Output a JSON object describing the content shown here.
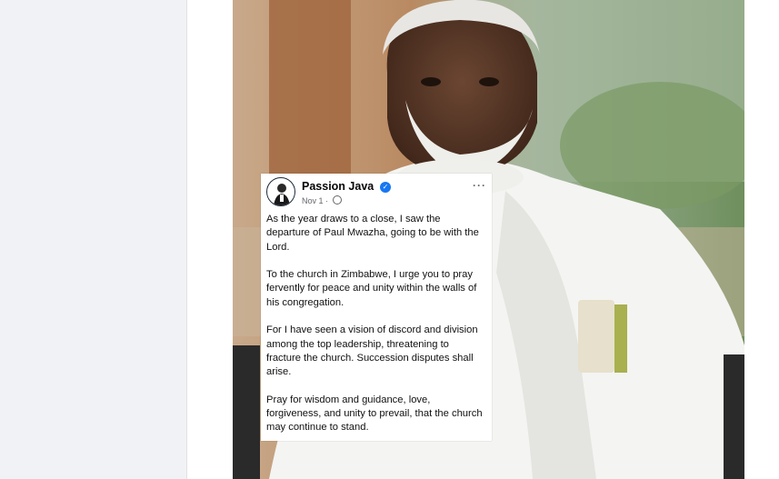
{
  "post": {
    "author": "Passion Java",
    "date": "Nov 1",
    "meta_separator": " · ",
    "more_label": "···",
    "paragraphs": [
      "As the year draws to a close, I saw the departure of Paul Mwazha, going to be with the Lord.",
      "To the church in Zimbabwe, I urge you to pray fervently for peace and unity within the walls of his congregation.",
      "For I have seen a vision of discord and division among the top leadership, threatening to fracture the church. Succession disputes shall arise.",
      "Pray for wisdom and guidance, love, forgiveness, and unity to prevail, that the church may continue to stand."
    ]
  },
  "icons": {
    "verified": "verified-badge-icon",
    "privacy": "globe-icon",
    "more": "more-options-icon"
  },
  "colors": {
    "verified_blue": "#1877f2",
    "left_panel": "#f0f2f5",
    "robe": "#f4f4f2"
  }
}
